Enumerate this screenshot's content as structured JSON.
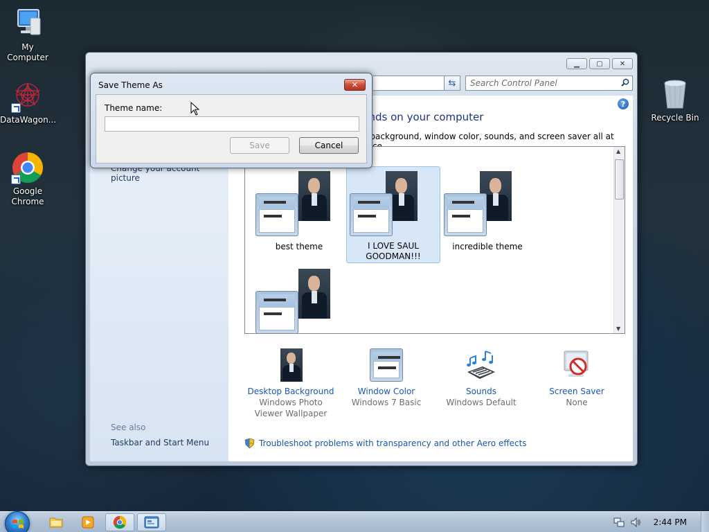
{
  "desktop": {
    "icons": [
      {
        "label": "My Computer",
        "icon": "computer-icon"
      },
      {
        "label": "DataWagon...",
        "icon": "datawagon-icon"
      },
      {
        "label": "Google Chrome",
        "icon": "chrome-icon"
      },
      {
        "label": "Recycle Bin",
        "icon": "recycle-bin-icon"
      }
    ]
  },
  "control_panel": {
    "search_placeholder": "Search Control Panel",
    "heading": "unds on your computer",
    "subheading": "p background, window color, sounds, and screen saver all at once.",
    "left_links": {
      "change_account_picture": "Change your account picture",
      "see_also": "See also",
      "taskbar_start_menu": "Taskbar and Start Menu"
    },
    "themes": [
      {
        "label": "best theme",
        "selected": false
      },
      {
        "label": "I LOVE SAUL GOODMAN!!!",
        "selected": true
      },
      {
        "label": "incredible theme",
        "selected": false
      },
      {
        "label": "",
        "selected": false
      }
    ],
    "settings": [
      {
        "title": "Desktop Background",
        "sub": "Windows Photo Viewer Wallpaper",
        "icon": "desktop-background-icon"
      },
      {
        "title": "Window Color",
        "sub": "Windows 7 Basic",
        "icon": "window-color-icon"
      },
      {
        "title": "Sounds",
        "sub": "Windows Default",
        "icon": "sounds-icon"
      },
      {
        "title": "Screen Saver",
        "sub": "None",
        "icon": "screen-saver-icon"
      }
    ],
    "troubleshoot_link": "Troubleshoot problems with transparency and other Aero effects"
  },
  "dialog": {
    "title": "Save Theme As",
    "field_label": "Theme name:",
    "field_value": "",
    "save_label": "Save",
    "save_enabled": false,
    "cancel_label": "Cancel"
  },
  "taskbar": {
    "clock": "2:44 PM",
    "pinned": [
      "file-explorer-icon",
      "media-player-icon",
      "chrome-icon",
      "control-panel-icon"
    ]
  },
  "colors": {
    "link_blue": "#1a56b6",
    "heading_blue": "#1e3287",
    "selection": "#d7e7f8"
  }
}
